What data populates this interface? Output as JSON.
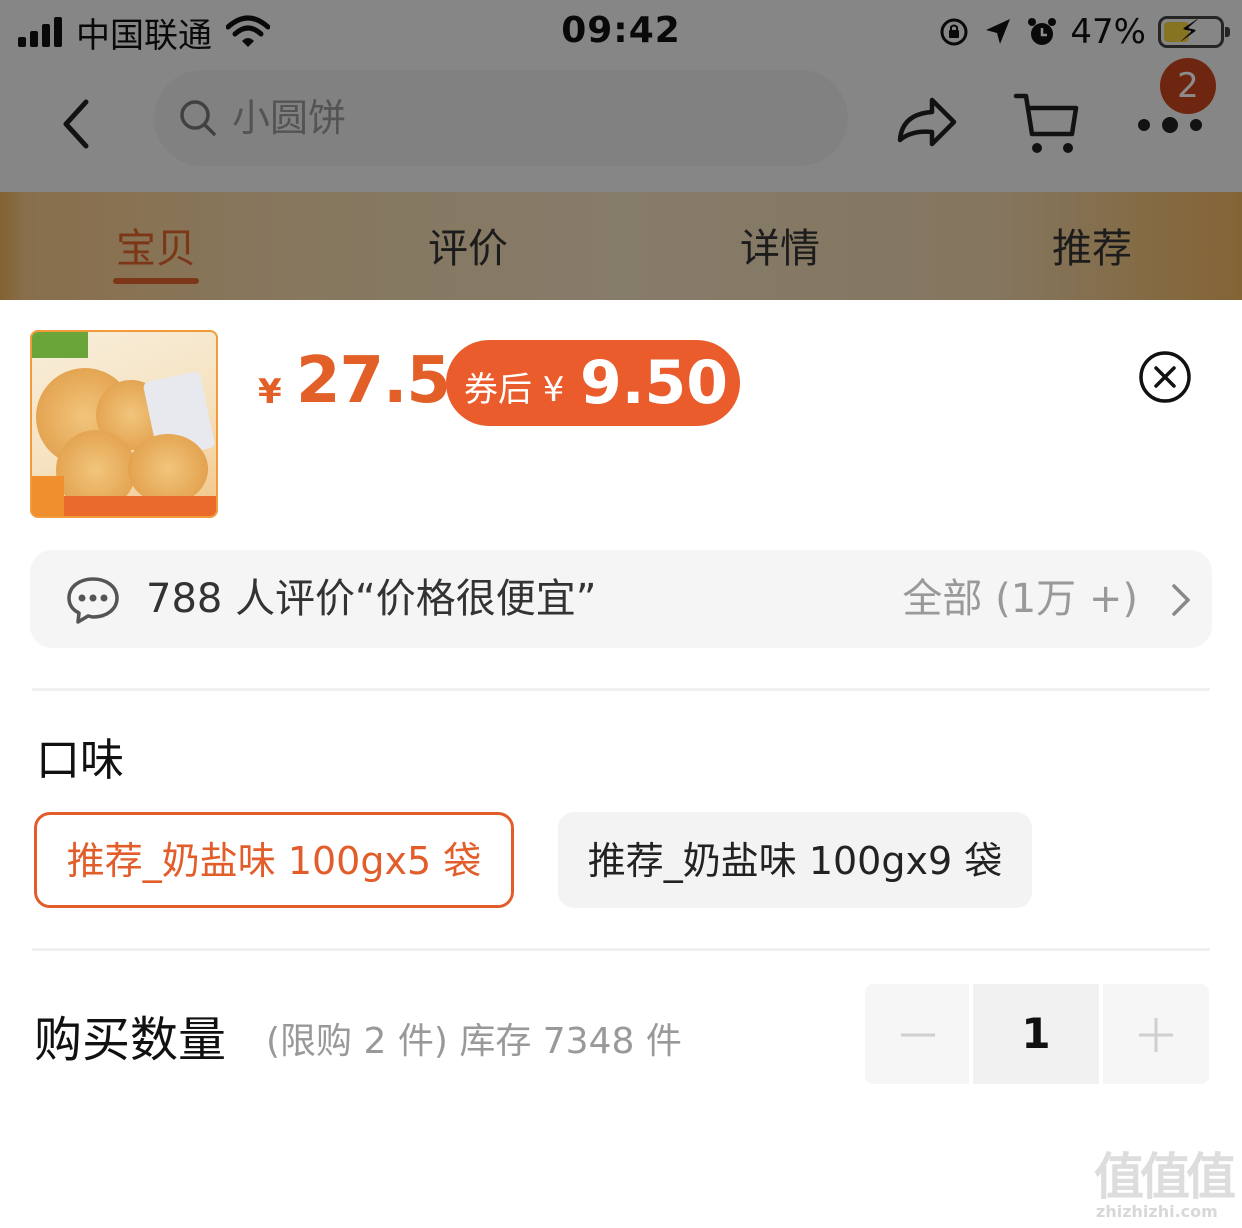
{
  "status_bar": {
    "carrier": "中国联通",
    "time": "09:42",
    "battery_percent": "47%",
    "battery_level": 0.47,
    "icons": [
      "signal-icon",
      "wifi-icon",
      "rotation-lock-icon",
      "location-icon",
      "alarm-icon",
      "battery-icon"
    ]
  },
  "nav": {
    "search_placeholder": "小圆饼",
    "cart_badge": "2",
    "icons": [
      "back-icon",
      "search-icon",
      "share-icon",
      "cart-icon",
      "more-icon"
    ]
  },
  "tabs": [
    "宝贝",
    "评价",
    "详情",
    "推荐"
  ],
  "active_tab": "宝贝",
  "sku_sheet": {
    "currency_symbol": "¥",
    "price": "27.5",
    "coupon_label": "券后 ¥",
    "coupon_price": "9.50",
    "review_summary": "788 人评价“价格很便宜”",
    "review_all": "全部 (1万 +)",
    "flavor_title": "口味",
    "flavor_options": [
      {
        "label": "推荐_奶盐味 100gx5 袋",
        "selected": true
      },
      {
        "label": "推荐_奶盐味 100gx9 袋",
        "selected": false
      }
    ],
    "quantity_title": "购买数量",
    "quantity_note": "(限购 2 件) 库存 7348 件",
    "quantity_value": "1"
  },
  "watermark": {
    "glyphs": "值值值",
    "url": "zhizhizhi.com"
  },
  "colors": {
    "accent": "#e35f28",
    "coupon_bg": "#ea5c2b",
    "badge": "#c8461e"
  }
}
